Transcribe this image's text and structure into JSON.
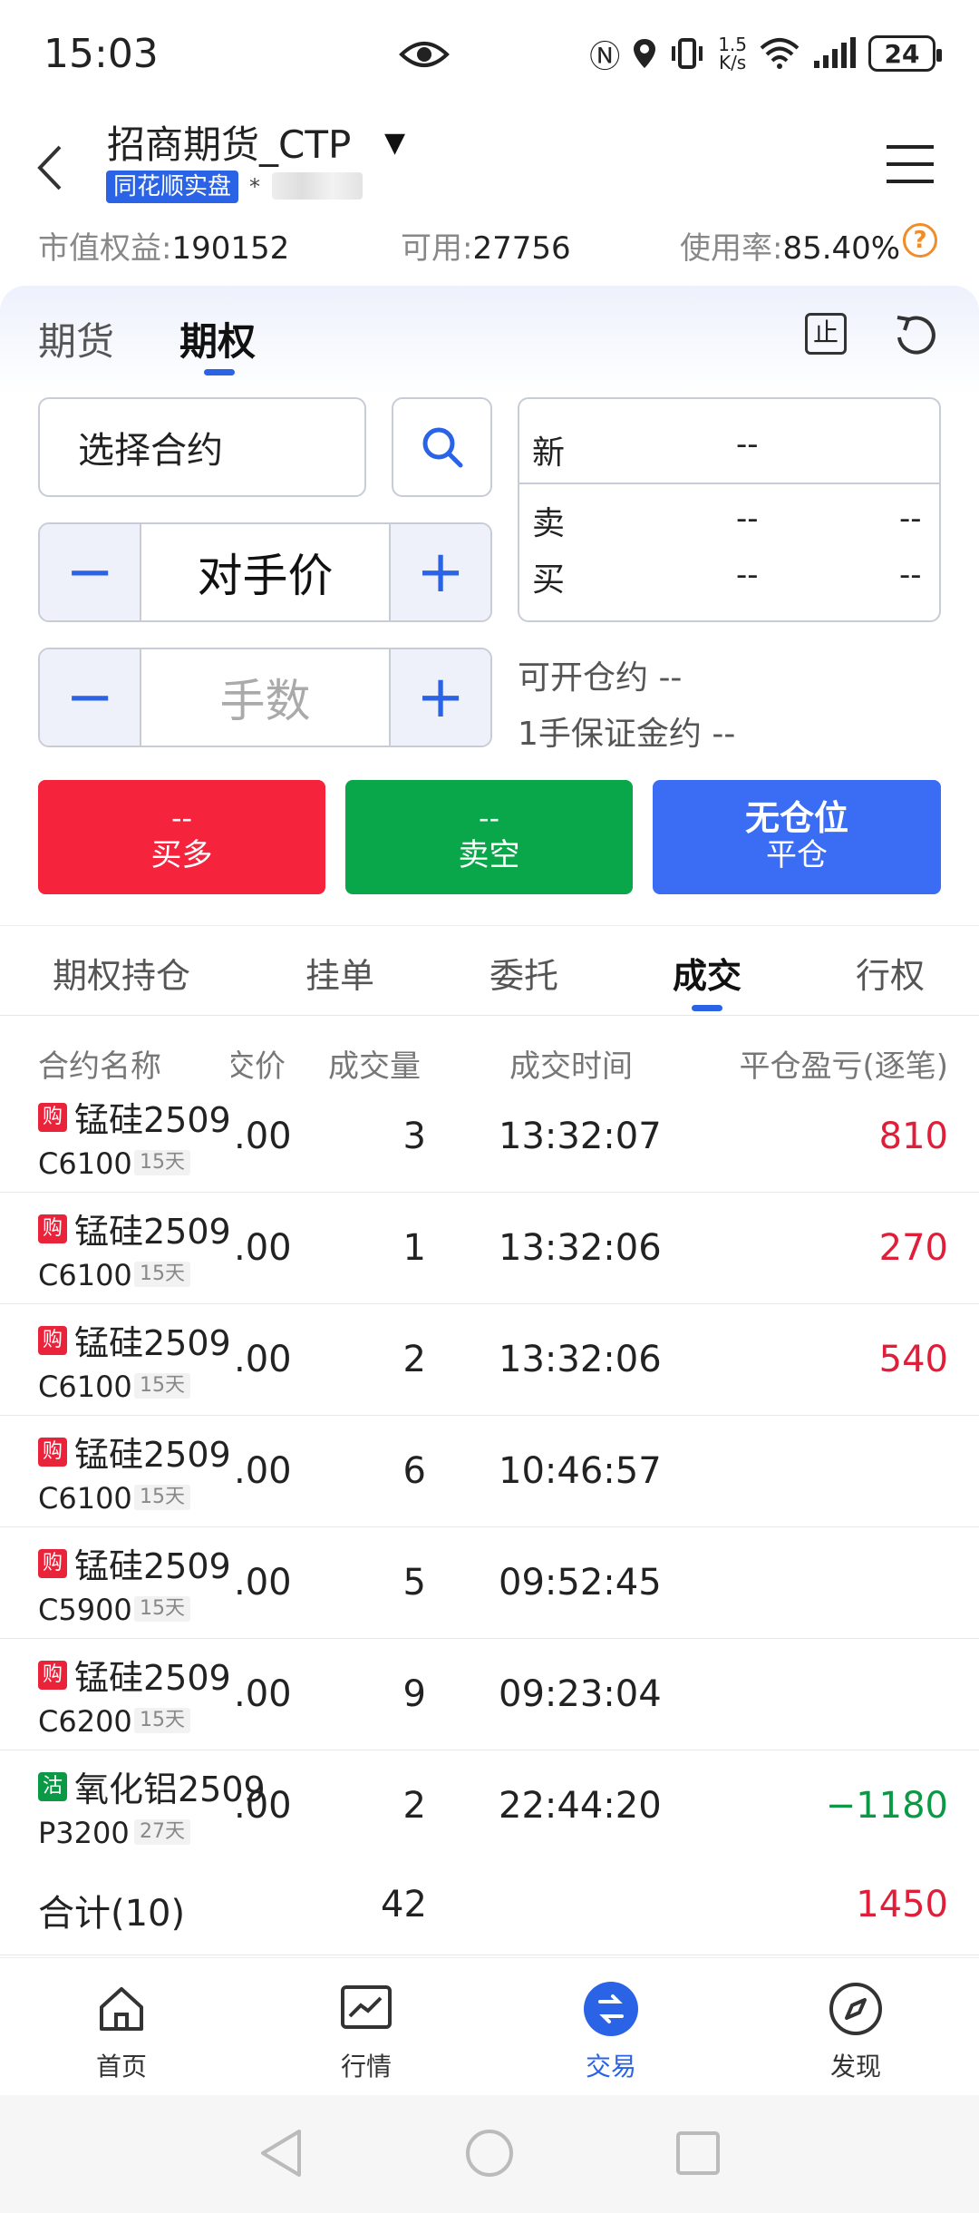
{
  "status_bar": {
    "time": "15:03",
    "net_speed_value": "1.5",
    "net_speed_unit": "K/s",
    "battery": "24",
    "signal_label": "6"
  },
  "header": {
    "account_name": "招商期货_CTP",
    "caret": "▼",
    "badge": "同花顺实盘",
    "masked_id": "*"
  },
  "summary": {
    "equity_label": "市值权益:",
    "equity_value": "190152",
    "available_label": "可用:",
    "available_value": "27756",
    "usage_label": "使用率:",
    "usage_value": "85.40%",
    "help_glyph": "?"
  },
  "tabs": {
    "futures": "期货",
    "options": "期权"
  },
  "toolbar": {
    "stop_glyph": "止"
  },
  "order_form": {
    "contract_select": "选择合约",
    "price_label": "对手价",
    "qty_placeholder": "手数",
    "minus": "−",
    "plus": "+"
  },
  "quote": {
    "new_label": "新",
    "new_value": "--",
    "sell_label": "卖",
    "sell_price": "--",
    "sell_qty": "--",
    "buy_label": "买",
    "buy_price": "--",
    "buy_qty": "--"
  },
  "info": {
    "openable": "可开仓约 --",
    "margin": "1手保证金约 --"
  },
  "buttons": {
    "buy_top": "--",
    "buy_label": "买多",
    "sell_top": "--",
    "sell_label": "卖空",
    "close_top": "无仓位",
    "close_label": "平仓"
  },
  "subtabs": {
    "positions": "期权持仓",
    "pending": "挂单",
    "orders": "委托",
    "trades": "成交",
    "exercise": "行权"
  },
  "table": {
    "headers": {
      "name": "合约名称",
      "price": "交价",
      "qty": "成交量",
      "time": "成交时间",
      "pnl": "平仓盈亏(逐笔)"
    },
    "rows": [
      {
        "tag": "购",
        "tag_color": "#e8233a",
        "name": "锰硅2509",
        "strike": "C6100",
        "days": "15天",
        "price": ".00",
        "qty": "3",
        "time": "13:32:07",
        "pnl": "810",
        "pnl_color": "red"
      },
      {
        "tag": "购",
        "tag_color": "#e8233a",
        "name": "锰硅2509",
        "strike": "C6100",
        "days": "15天",
        "price": ".00",
        "qty": "1",
        "time": "13:32:06",
        "pnl": "270",
        "pnl_color": "red"
      },
      {
        "tag": "购",
        "tag_color": "#e8233a",
        "name": "锰硅2509",
        "strike": "C6100",
        "days": "15天",
        "price": ".00",
        "qty": "2",
        "time": "13:32:06",
        "pnl": "540",
        "pnl_color": "red"
      },
      {
        "tag": "购",
        "tag_color": "#e8233a",
        "name": "锰硅2509",
        "strike": "C6100",
        "days": "15天",
        "price": ".00",
        "qty": "6",
        "time": "10:46:57",
        "pnl": "",
        "pnl_color": ""
      },
      {
        "tag": "购",
        "tag_color": "#e8233a",
        "name": "锰硅2509",
        "strike": "C5900",
        "days": "15天",
        "price": ".00",
        "qty": "5",
        "time": "09:52:45",
        "pnl": "",
        "pnl_color": ""
      },
      {
        "tag": "购",
        "tag_color": "#e8233a",
        "name": "锰硅2509",
        "strike": "C6200",
        "days": "15天",
        "price": ".00",
        "qty": "9",
        "time": "09:23:04",
        "pnl": "",
        "pnl_color": ""
      },
      {
        "tag": "沽",
        "tag_color": "#0a9a45",
        "name": "氧化铝2509",
        "strike": "P3200",
        "days": "27天",
        "price": ".00",
        "qty": "2",
        "time": "22:44:20",
        "pnl": "−1180",
        "pnl_color": "green"
      }
    ],
    "total": {
      "label": "合计(10)",
      "qty": "42",
      "pnl": "1450"
    }
  },
  "bottom_nav": {
    "home": "首页",
    "market": "行情",
    "trade": "交易",
    "discover": "发现"
  },
  "colors": {
    "accent": "#2a63e6",
    "buy": "#f5233c",
    "sell": "#0aa64a",
    "close": "#3a6cf4",
    "profit": "#e01e3a",
    "loss": "#0a9a45"
  }
}
